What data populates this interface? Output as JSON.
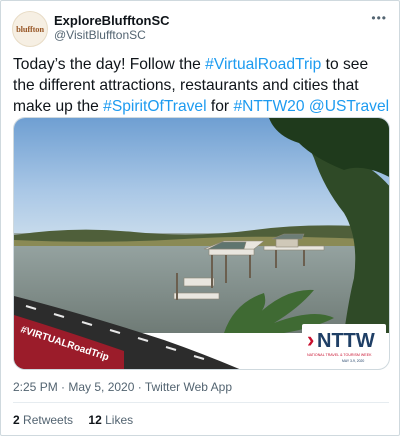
{
  "account": {
    "avatar_text": "bluffton",
    "display_name": "ExploreBlufftonSC",
    "handle": "@VisitBlufftonSC"
  },
  "tweet": {
    "segments": [
      {
        "text": "Today’s the day! Follow the ",
        "link": false
      },
      {
        "text": "#VirtualRoadTrip",
        "link": true
      },
      {
        "text": " to see the different attractions, restaurants and cities that make up the ",
        "link": false
      },
      {
        "text": "#SpiritOfTravel",
        "link": true
      },
      {
        "text": " for ",
        "link": false
      },
      {
        "text": "#NTTW20",
        "link": true
      },
      {
        "text": " ",
        "link": false
      },
      {
        "text": "@USTravel",
        "link": true
      }
    ]
  },
  "media": {
    "banner_text": "#VIRTUALRoadTrip",
    "logo_main": "NTTW",
    "logo_line1": "NATIONAL TRAVEL & TOURISM WEEK",
    "logo_line2": "MAY 3-9, 2020"
  },
  "meta": {
    "timestamp": "2:25 PM · May 5, 2020 · Twitter Web App"
  },
  "stats": {
    "retweets_count": "2",
    "retweets_label": "Retweets",
    "likes_count": "12",
    "likes_label": "Likes"
  },
  "icons": {
    "more": "more-options-icon"
  },
  "colors": {
    "link": "#1d9bf0",
    "text": "#0f1419",
    "secondary": "#536471",
    "banner": "#9b1c2a",
    "logo_accent": "#c8102e",
    "logo_text": "#1f3f66"
  }
}
